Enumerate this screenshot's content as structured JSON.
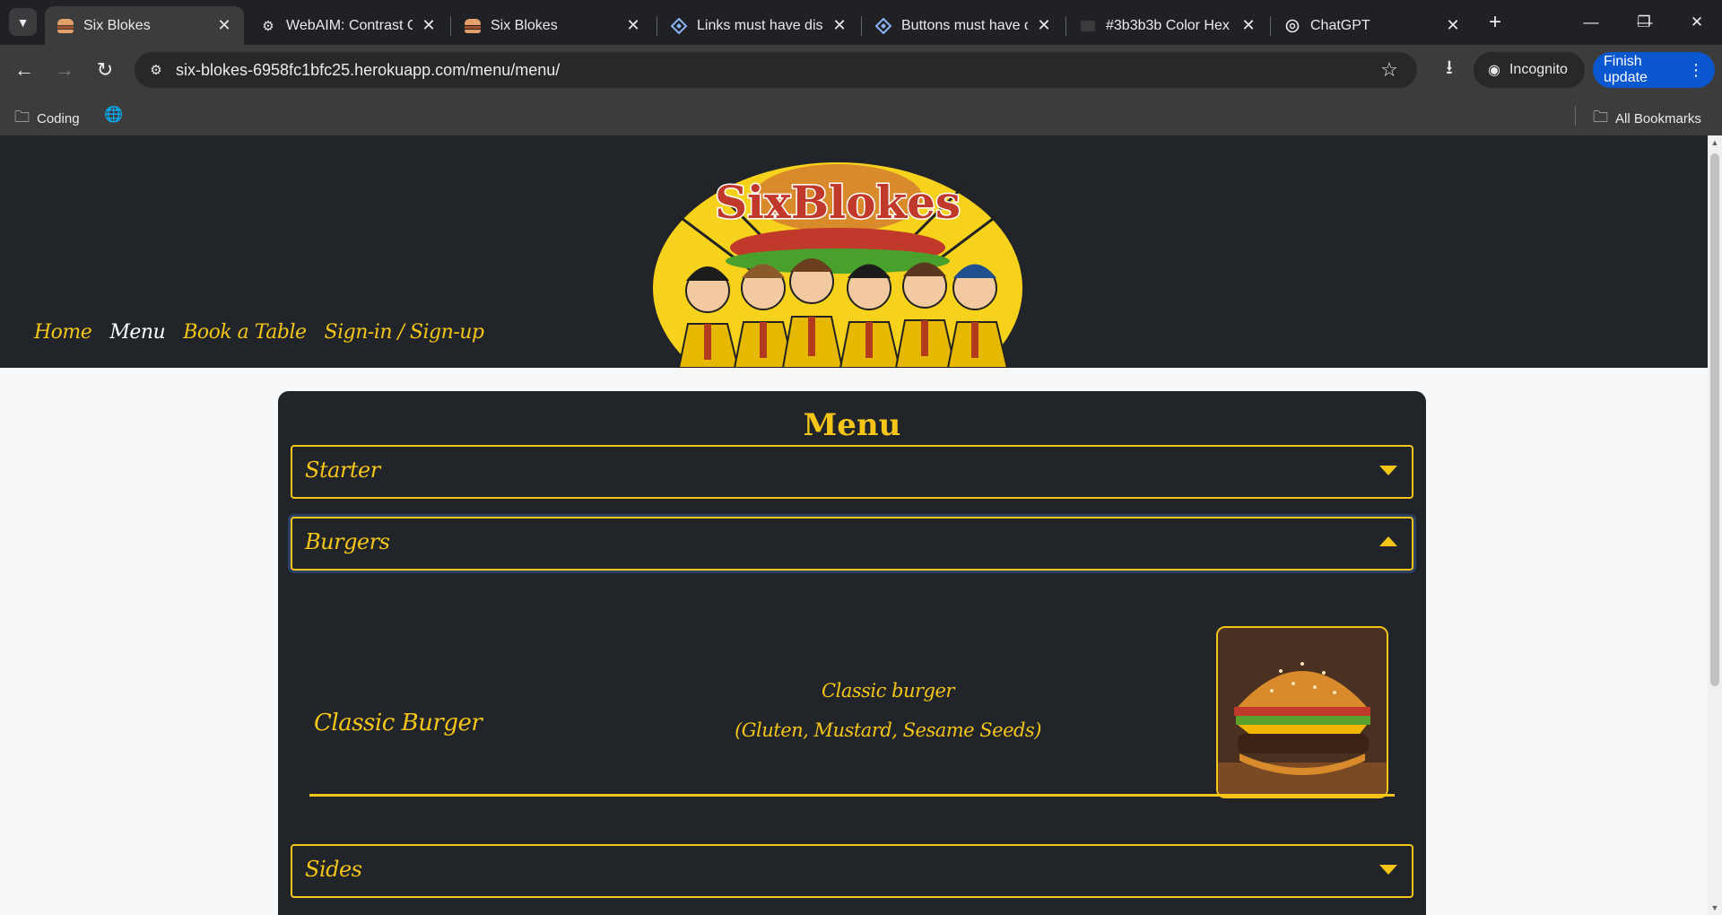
{
  "browser": {
    "tabs": [
      {
        "title": "Six Blokes",
        "icon": "burger-icon",
        "active": true
      },
      {
        "title": "WebAIM: Contrast Ch",
        "icon": "gear-icon",
        "active": false
      },
      {
        "title": "Six Blokes",
        "icon": "burger-icon",
        "active": false
      },
      {
        "title": "Links must have disc",
        "icon": "axe-icon",
        "active": false
      },
      {
        "title": "Buttons must have d",
        "icon": "axe-icon",
        "active": false
      },
      {
        "title": "#3b3b3b Color Hex C",
        "icon": "colorhex-icon",
        "active": false
      },
      {
        "title": "ChatGPT",
        "icon": "chatgpt-icon",
        "active": false
      }
    ],
    "url": "six-blokes-6958fc1bfc25.herokuapp.com/menu/menu/",
    "incognito_label": "Incognito",
    "finish_update_label": "Finish update",
    "bookmarks": [
      {
        "label": "Coding",
        "icon": "folder-icon"
      },
      {
        "label": "",
        "icon": "globe-icon"
      }
    ],
    "all_bookmarks_label": "All Bookmarks"
  },
  "site": {
    "logo_text": "SixBlokes",
    "nav": [
      {
        "label": "Home",
        "current": false
      },
      {
        "label": "Menu",
        "current": true
      },
      {
        "label": "Book a Table",
        "current": false
      },
      {
        "label": "Sign-in / Sign-up",
        "current": false
      }
    ],
    "menu_title": "Menu",
    "sections": [
      {
        "label": "Starter",
        "expanded": false
      },
      {
        "label": "Burgers",
        "expanded": true
      },
      {
        "label": "Sides",
        "expanded": false
      }
    ],
    "item": {
      "name": "Classic Burger",
      "description": "Classic burger",
      "allergens": "(Gluten, Mustard, Sesame Seeds)"
    },
    "colors": {
      "accent": "#f5c518",
      "header_bg": "#212529",
      "page_bg": "#f7f8f9"
    }
  }
}
